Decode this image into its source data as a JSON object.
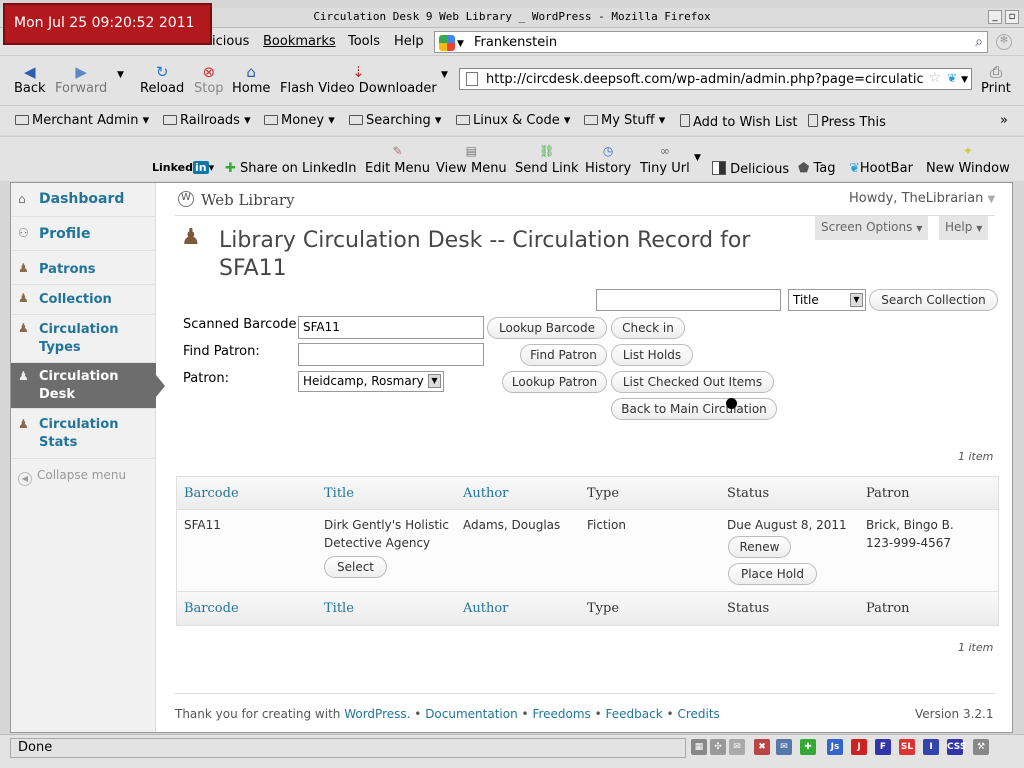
{
  "clock": "Mon Jul 25 09:20:52 2011",
  "window": {
    "title": "Circulation Desk  9 Web Library  _ WordPress - Mozilla Firefox"
  },
  "menubar": {
    "items": [
      "icious",
      "Bookmarks",
      "Tools",
      "Help"
    ]
  },
  "websearch": {
    "value": "Frankenstein"
  },
  "nav": {
    "back": "Back",
    "forward": "Forward",
    "reload": "Reload",
    "stop": "Stop",
    "home": "Home",
    "flash": "Flash Video Downloader",
    "print": "Print"
  },
  "url": "http://circdesk.deepsoft.com/wp-admin/admin.php?page=circulatic",
  "bookmarks": [
    "Merchant Admin",
    "Railroads",
    "Money",
    "Searching",
    "Linux & Code",
    "My Stuff",
    "Add to Wish List",
    "Press This"
  ],
  "linkbar": {
    "linkedin": "Linked",
    "share": "Share on LinkedIn",
    "editmenu": "Edit Menu",
    "viewmenu": "View Menu",
    "sendlink": "Send Link",
    "history": "History",
    "tinyurl": "Tiny Url",
    "delicious": "Delicious",
    "tag": "Tag",
    "hootbar": "HootBar",
    "newwindow": "New Window"
  },
  "sidebar": {
    "items": [
      "Dashboard",
      "Profile",
      "Patrons",
      "Collection",
      "Circulation Types",
      "Circulation Desk",
      "Circulation Stats"
    ],
    "collapse": "Collapse menu"
  },
  "header": {
    "site": "Web Library",
    "howdy": "Howdy, TheLibrarian",
    "screen_options": "Screen Options",
    "help": "Help"
  },
  "page": {
    "title": "Library Circulation Desk -- Circulation Record for SFA11"
  },
  "search": {
    "field": "Title",
    "button": "Search Collection"
  },
  "form": {
    "scanned_label": "Scanned Barcode",
    "scanned_value": "SFA11",
    "find_label": "Find Patron:",
    "find_value": "",
    "patron_label": "Patron:",
    "patron_value": "Heidcamp, Rosmary",
    "lookup_barcode": "Lookup Barcode",
    "check_in": "Check in",
    "find_patron": "Find Patron",
    "list_holds": "List Holds",
    "lookup_patron": "Lookup Patron",
    "list_checked_out": "List Checked Out Items",
    "back_main": "Back to Main Circulation"
  },
  "table": {
    "count": "1 item",
    "headers": [
      "Barcode",
      "Title",
      "Author",
      "Type",
      "Status",
      "Patron"
    ],
    "row": {
      "barcode": "SFA11",
      "title": "Dirk Gently's Holistic Detective Agency",
      "select": "Select",
      "author": "Adams, Douglas",
      "type": "Fiction",
      "status": "Due August 8, 2011",
      "renew": "Renew",
      "place_hold": "Place Hold",
      "patron_name": "Brick, Bingo B.",
      "patron_phone": "123-999-4567"
    }
  },
  "footer": {
    "thanks": "Thank you for creating with",
    "wordpress": "WordPress.",
    "sep": "•",
    "links": [
      "Documentation",
      "Freedoms",
      "Feedback",
      "Credits"
    ],
    "version": "Version 3.2.1"
  },
  "status": {
    "text": "Done"
  },
  "colors": {
    "accent": "#21759b",
    "clock_bg": "#b3181e",
    "current_menu": "#6d6d6d"
  }
}
